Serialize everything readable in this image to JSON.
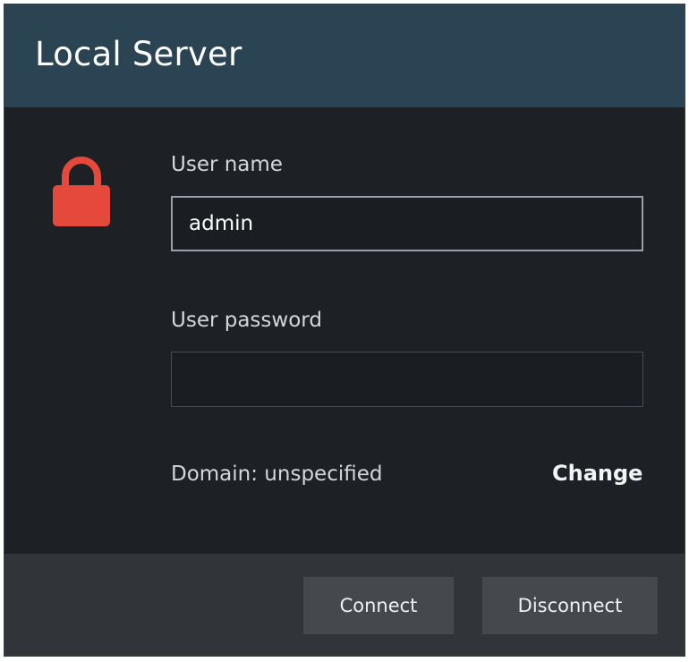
{
  "dialog": {
    "title": "Local Server"
  },
  "icons": {
    "lock": "lock-icon"
  },
  "colors": {
    "titlebar": "#2a4454",
    "background": "#1d2126",
    "footer": "#31353a",
    "button": "#45494e",
    "lock": "#e5493b"
  },
  "form": {
    "username_label": "User name",
    "username_value": "admin",
    "password_label": "User password",
    "password_value": "",
    "domain_text": "Domain: unspecified",
    "change_label": "Change"
  },
  "footer": {
    "connect_label": "Connect",
    "disconnect_label": "Disconnect"
  }
}
